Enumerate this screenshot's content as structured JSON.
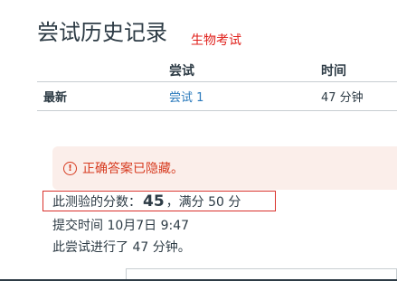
{
  "page": {
    "title": "尝试历史记录",
    "annotation": "生物考试"
  },
  "history_table": {
    "columns": [
      "",
      "尝试",
      "时间"
    ],
    "rows": [
      {
        "label": "最新",
        "attempt": "尝试 1",
        "duration": "47 分钟"
      }
    ]
  },
  "notice": {
    "icon": "warning-circle-icon",
    "text": "正确答案已隐藏。"
  },
  "score": {
    "prefix": "此测验的分数：",
    "value": "45",
    "suffix": "，满分 50 分"
  },
  "submission": {
    "submitted": "提交时间 10月7日 9:47",
    "duration_text": "此尝试进行了 47 分钟。"
  },
  "colors": {
    "annotation": "#e0201b",
    "link": "#2b7abc",
    "notice_bg": "#fbeeea",
    "notice_text": "#d73b20",
    "highlight_border": "#d9312b"
  }
}
